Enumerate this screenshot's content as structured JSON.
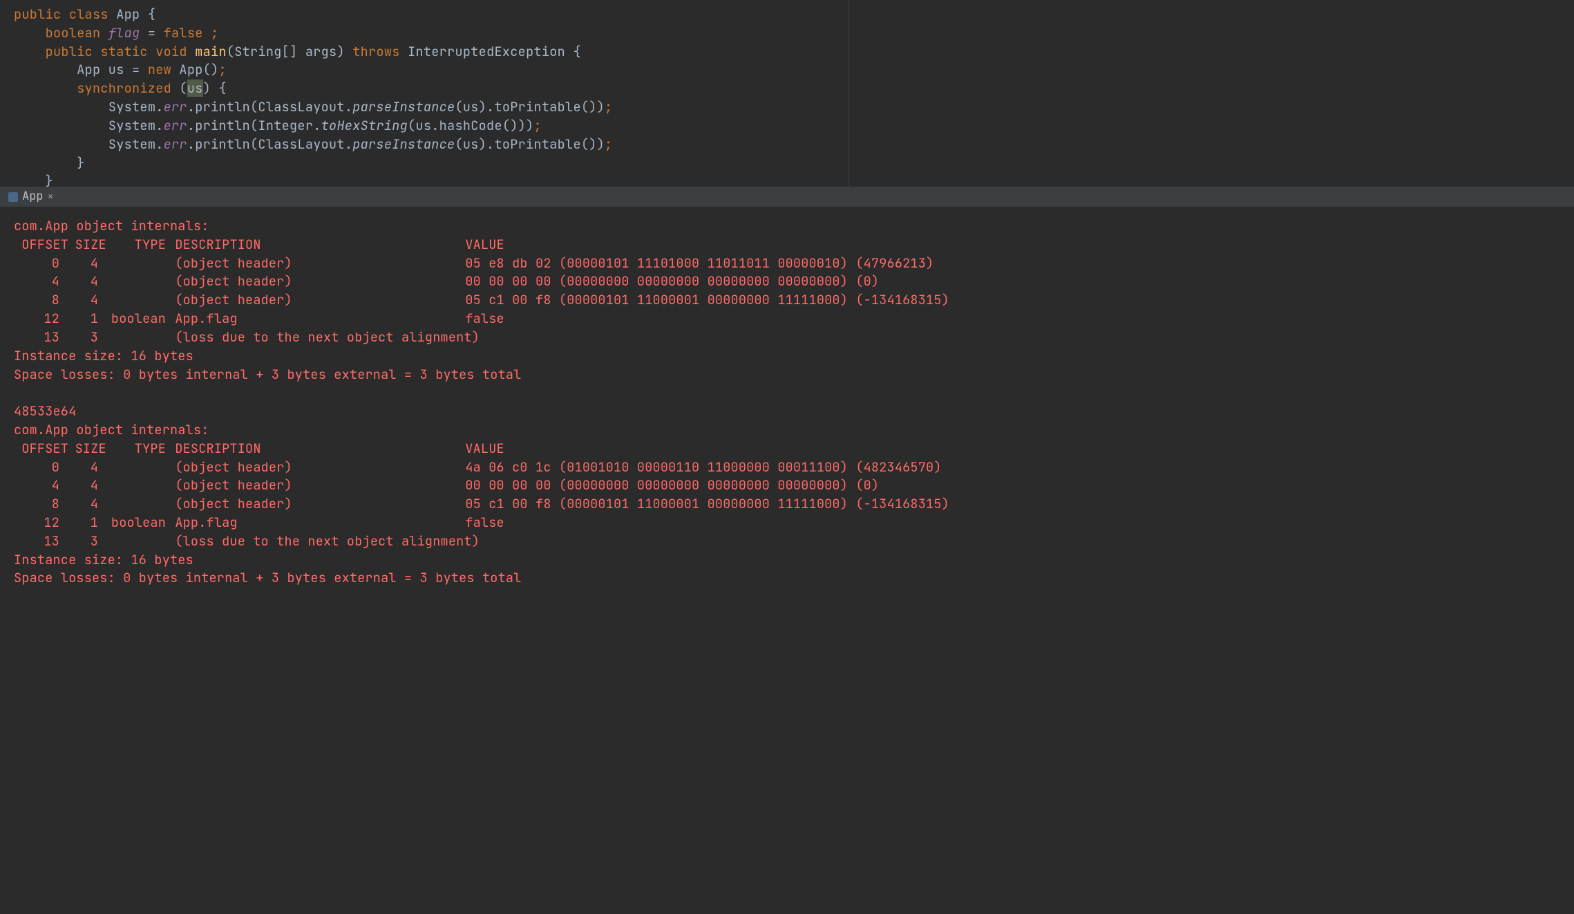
{
  "editor": {
    "lines": [
      {
        "t": "class",
        "tokens": [
          "public ",
          "class ",
          "App {"
        ]
      },
      {
        "t": "field",
        "indent": "    ",
        "tokens": [
          "boolean ",
          "flag",
          " = ",
          "false",
          " ",
          ";"
        ]
      },
      {
        "t": "method",
        "indent": "    ",
        "tokens": [
          "public ",
          "static ",
          "void ",
          "main",
          "(String[] args) ",
          "throws ",
          "InterruptedException",
          " {"
        ]
      },
      {
        "t": "stmt",
        "indent": "        ",
        "tokens": [
          "App us = ",
          "new ",
          "App()",
          ";"
        ]
      },
      {
        "t": "sync",
        "indent": "        ",
        "tokens": [
          "synchronized ",
          "(",
          "us",
          ") {"
        ]
      },
      {
        "t": "print1",
        "indent": "            ",
        "tokens": [
          "System.",
          "err",
          ".println(ClassLayout.",
          "parseInstance",
          "(us).toPrintable())",
          ";"
        ]
      },
      {
        "t": "print2",
        "indent": "            ",
        "tokens": [
          "System.",
          "err",
          ".println(Integer.",
          "toHexString",
          "(us.hashCode()))",
          ";"
        ]
      },
      {
        "t": "print3",
        "indent": "            ",
        "tokens": [
          "System.",
          "err",
          ".println(ClassLayout.",
          "parseInstance",
          "(us).toPrintable())",
          ";"
        ]
      },
      {
        "t": "close",
        "indent": "        ",
        "tokens": [
          "}"
        ]
      },
      {
        "t": "close",
        "indent": "    ",
        "tokens": [
          "}"
        ]
      }
    ]
  },
  "tab": {
    "label": "App",
    "close": "×"
  },
  "console": {
    "blocks": [
      {
        "header": "com.App object internals:",
        "cols": {
          "offset": "OFFSET",
          "size": "SIZE",
          "type": "TYPE",
          "desc": "DESCRIPTION",
          "value": "VALUE"
        },
        "rows": [
          {
            "offset": "0",
            "size": "4",
            "type": "",
            "desc": "(object header)",
            "value": "05 e8 db 02 (00000101 11101000 11011011 00000010) (47966213)"
          },
          {
            "offset": "4",
            "size": "4",
            "type": "",
            "desc": "(object header)",
            "value": "00 00 00 00 (00000000 00000000 00000000 00000000) (0)"
          },
          {
            "offset": "8",
            "size": "4",
            "type": "",
            "desc": "(object header)",
            "value": "05 c1 00 f8 (00000101 11000001 00000000 11111000) (-134168315)"
          },
          {
            "offset": "12",
            "size": "1",
            "type": "boolean",
            "desc": "App.flag",
            "value": "false"
          },
          {
            "offset": "13",
            "size": "3",
            "type": "",
            "desc": "(loss due to the next object alignment)",
            "value": ""
          }
        ],
        "footer1": "Instance size: 16 bytes",
        "footer2": "Space losses: 0 bytes internal + 3 bytes external = 3 bytes total"
      },
      {
        "hash": "48533e64",
        "header": "com.App object internals:",
        "cols": {
          "offset": "OFFSET",
          "size": "SIZE",
          "type": "TYPE",
          "desc": "DESCRIPTION",
          "value": "VALUE"
        },
        "rows": [
          {
            "offset": "0",
            "size": "4",
            "type": "",
            "desc": "(object header)",
            "value": "4a 06 c0 1c (01001010 00000110 11000000 00011100) (482346570)"
          },
          {
            "offset": "4",
            "size": "4",
            "type": "",
            "desc": "(object header)",
            "value": "00 00 00 00 (00000000 00000000 00000000 00000000) (0)"
          },
          {
            "offset": "8",
            "size": "4",
            "type": "",
            "desc": "(object header)",
            "value": "05 c1 00 f8 (00000101 11000001 00000000 11111000) (-134168315)"
          },
          {
            "offset": "12",
            "size": "1",
            "type": "boolean",
            "desc": "App.flag",
            "value": "false"
          },
          {
            "offset": "13",
            "size": "3",
            "type": "",
            "desc": "(loss due to the next object alignment)",
            "value": ""
          }
        ],
        "footer1": "Instance size: 16 bytes",
        "footer2": "Space losses: 0 bytes internal + 3 bytes external = 3 bytes total"
      }
    ]
  }
}
